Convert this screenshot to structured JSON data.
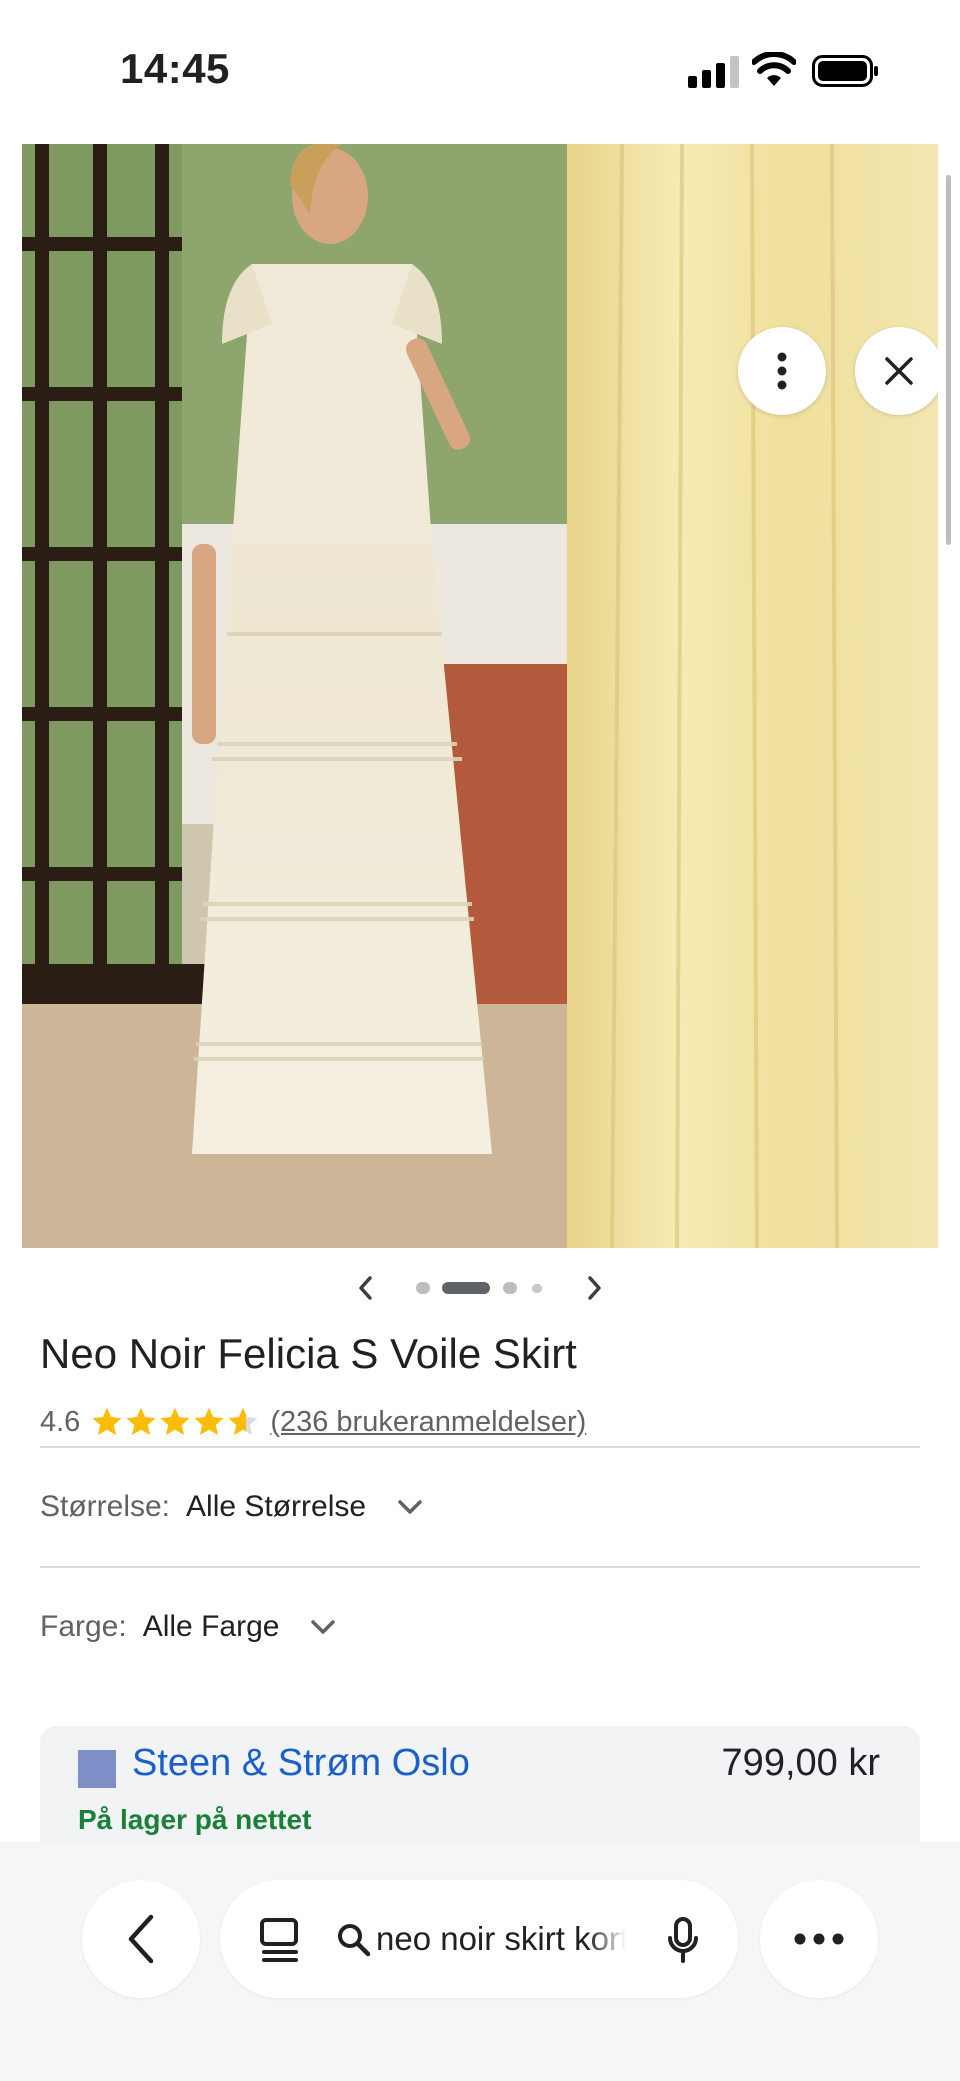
{
  "status_bar": {
    "time": "14:45",
    "icons": [
      "cellular-signal-icon",
      "wifi-icon",
      "battery-icon"
    ]
  },
  "image_viewer": {
    "actions": [
      "more-options-icon",
      "close-icon"
    ],
    "carousel": {
      "dot_count": 4,
      "active_index": 1
    }
  },
  "product": {
    "title": "Neo Noir Felicia S Voile Skirt",
    "rating": "4.6",
    "stars": 4.6,
    "reviews_link": "(236 brukeranmeldelser)"
  },
  "filters": {
    "size": {
      "label": "Størrelse:",
      "value": "Alle Størrelse"
    },
    "color": {
      "label": "Farge:",
      "value": "Alle Farge"
    }
  },
  "offer": {
    "store": "Steen & Strøm Oslo",
    "price": "799,00 kr",
    "availability": "På lager på nettet"
  },
  "toolbar": {
    "search_query": "neo noir skirt kort"
  },
  "colors": {
    "link_blue": "#1a5fcc",
    "stock_green": "#188038",
    "star_yellow": "#fbbc04"
  }
}
